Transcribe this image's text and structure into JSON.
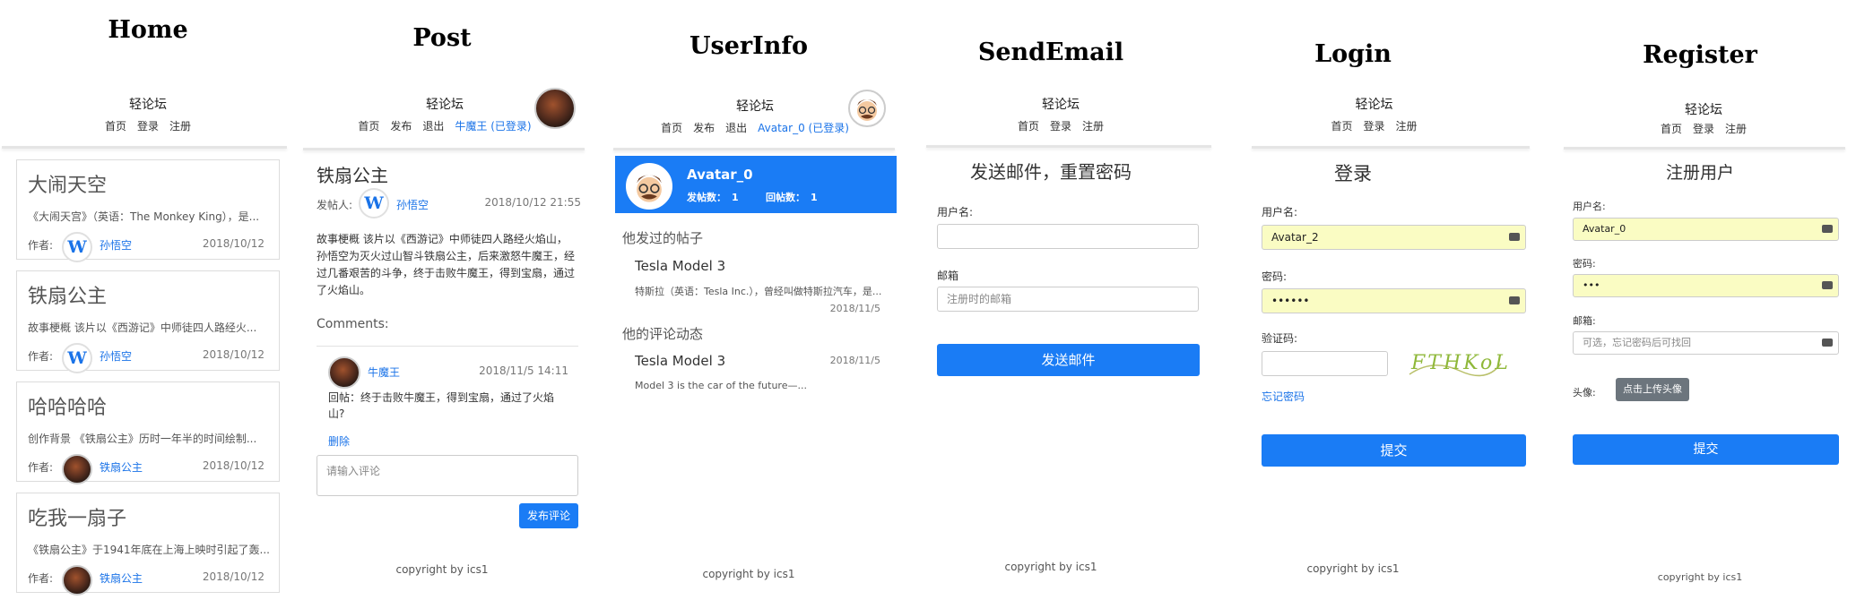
{
  "titles": [
    "Home",
    "Post",
    "UserInfo",
    "SendEmail",
    "Login",
    "Register"
  ],
  "brand": "轻论坛",
  "nav": {
    "home": "首页",
    "login": "登录",
    "register": "注册",
    "post": "发布",
    "logout": "退出"
  },
  "home": {
    "posts": [
      {
        "title": "大闹天空",
        "summary": "《大闹天宫》（英语：The Monkey King），是...",
        "author_label": "作者:",
        "author": "孙悟空",
        "date": "2018/10/12"
      },
      {
        "title": "铁扇公主",
        "summary": "故事梗概 该片以《西游记》中师徒四人路经火...",
        "author_label": "作者:",
        "author": "孙悟空",
        "date": "2018/10/12"
      },
      {
        "title": "哈哈哈哈",
        "summary": "创作背景 《铁扇公主》历时一年半的时间绘制...",
        "author_label": "作者:",
        "author": "铁扇公主",
        "date": "2018/10/12"
      },
      {
        "title": "吃我一扇子",
        "summary": "《铁扇公主》于1941年底在上海上映时引起了轰...",
        "author_label": "作者:",
        "author": "铁扇公主",
        "date": "2018/10/12"
      }
    ]
  },
  "post": {
    "nav_user": "牛魔王 (已登录)",
    "title": "铁扇公主",
    "poster_label": "发帖人:",
    "poster": "孙悟空",
    "date": "2018/10/12 21:55",
    "body": "故事梗概 该片以《西游记》中师徒四人路经火焰山，孙悟空为灭火过山智斗铁扇公主，后来激怒牛魔王，经过几番艰苦的斗争，终于击败牛魔王，得到宝扇，通过了火焰山。",
    "comments_label": "Comments:",
    "comment_user": "牛魔王",
    "comment_date": "2018/11/5 14:11",
    "comment_text": "回帖：终于击败牛魔王，得到宝扇，通过了火焰山?",
    "delete": "删除",
    "comment_placeholder": "请输入评论",
    "submit": "发布评论",
    "copyright": "copyright by ics1"
  },
  "userinfo": {
    "nav_user": "Avatar_0 (已登录)",
    "name": "Avatar_0",
    "posts_count_label": "发帖数：",
    "posts_count": "1",
    "replies_count_label": "回帖数：",
    "replies_count": "1",
    "posts_heading": "他发过的帖子",
    "post_title": "Tesla Model 3",
    "post_summary": "特斯拉（英语：Tesla Inc.），曾经叫做特斯拉汽车，是...",
    "post_date": "2018/11/5",
    "comments_heading": "他的评论动态",
    "comment_title": "Tesla Model 3",
    "comment_date": "2018/11/5",
    "comment_text": "Model 3 is the car of the future—...",
    "copyright": "copyright by ics1"
  },
  "sendemail": {
    "heading": "发送邮件，重置密码",
    "username_label": "用户名:",
    "email_label": "邮箱",
    "email_placeholder": "注册时的邮箱",
    "button": "发送邮件",
    "copyright": "copyright by ics1"
  },
  "login": {
    "heading": "登录",
    "username_label": "用户名:",
    "username_value": "Avatar_2",
    "password_label": "密码:",
    "password_value": "••••••",
    "captcha_label": "验证码:",
    "captcha_text": "FTHKoL",
    "forgot": "忘记密码",
    "button": "提交",
    "copyright": "copyright by ics1"
  },
  "register": {
    "heading": "注册用户",
    "username_label": "用户名:",
    "username_value": "Avatar_0",
    "password_label": "密码:",
    "password_value": "•••",
    "email_label": "邮箱:",
    "email_placeholder": "可选，忘记密码后可找回",
    "avatar_label": "头像:",
    "upload_button": "点击上传头像",
    "button": "提交",
    "copyright": "copyright by ics1"
  }
}
